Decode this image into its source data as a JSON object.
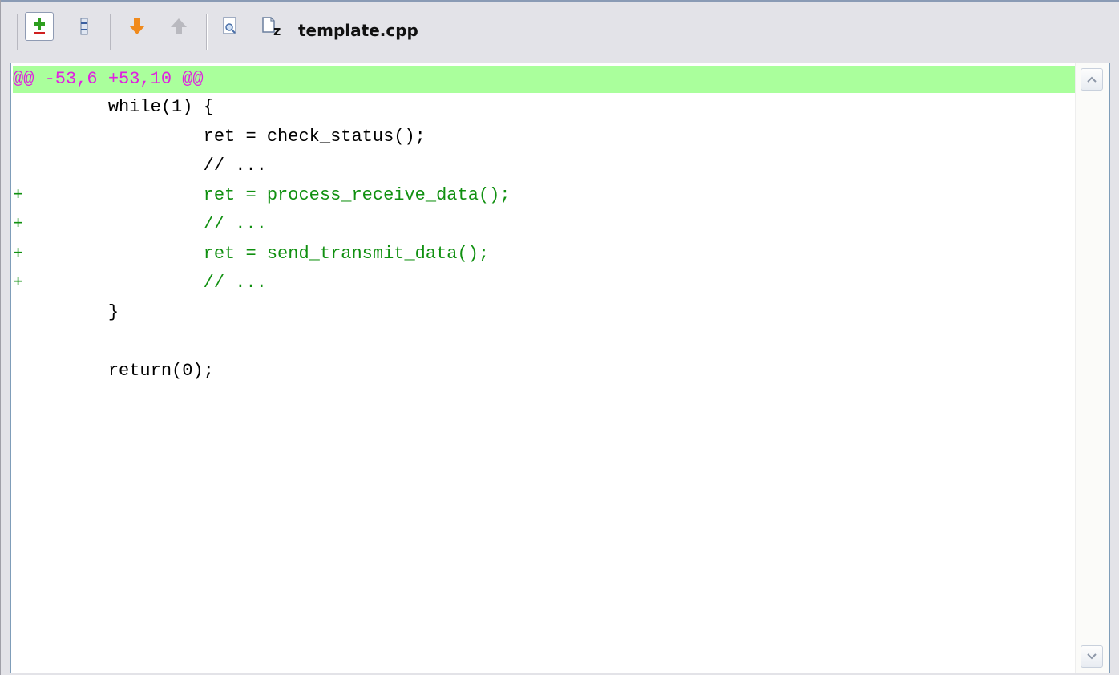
{
  "toolbar": {
    "file_name": "template.cpp",
    "buttons": [
      {
        "name": "toggle-diff-button",
        "icon": "plus-minus-icon"
      },
      {
        "name": "collapse-button",
        "icon": "collapse-lines-icon"
      },
      {
        "name": "next-change-button",
        "icon": "arrow-down-icon"
      },
      {
        "name": "previous-change-button",
        "icon": "arrow-up-icon"
      },
      {
        "name": "preview-button",
        "icon": "document-search-icon"
      },
      {
        "name": "file-type-button",
        "icon": "zip-file-icon"
      }
    ]
  },
  "diff": {
    "hunk_header": "@@ -53,6 +53,10 @@",
    "lines": [
      {
        "type": "context",
        "text": "         while(1) {"
      },
      {
        "type": "context",
        "text": "                  ret = check_status();"
      },
      {
        "type": "context",
        "text": "                  // ..."
      },
      {
        "type": "added",
        "text": "+                 ret = process_receive_data();"
      },
      {
        "type": "added",
        "text": "+                 // ..."
      },
      {
        "type": "added",
        "text": "+                 ret = send_transmit_data();"
      },
      {
        "type": "added",
        "text": "+                 // ..."
      },
      {
        "type": "context",
        "text": "         }"
      },
      {
        "type": "context",
        "text": ""
      },
      {
        "type": "context",
        "text": "         return(0);"
      }
    ]
  },
  "colors": {
    "hunk_background": "#aaff9c",
    "hunk_text": "#e020e0",
    "added_text": "#109010"
  }
}
